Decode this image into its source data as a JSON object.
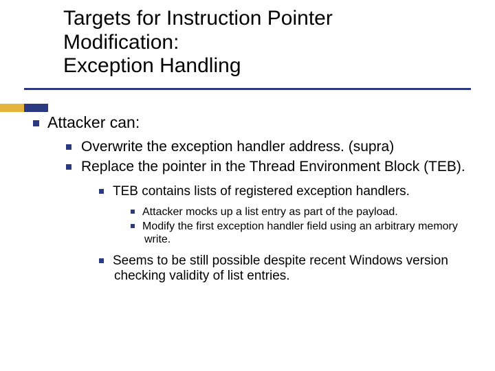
{
  "title_line1": "Targets for Instruction Pointer",
  "title_line2": "Modification:",
  "title_line3": "Exception Handling",
  "l1": "Attacker can:",
  "l2": [
    "Overwrite the exception handler address. (supra)",
    "Replace the pointer in the Thread Environment Block (TEB)."
  ],
  "l3a": "TEB contains lists of registered exception handlers.",
  "l4": [
    "Attacker mocks up a list entry as part of the payload.",
    "Modify the first exception handler field using an arbitrary memory write."
  ],
  "l3b": "Seems to be still possible despite recent Windows version checking validity of list entries."
}
